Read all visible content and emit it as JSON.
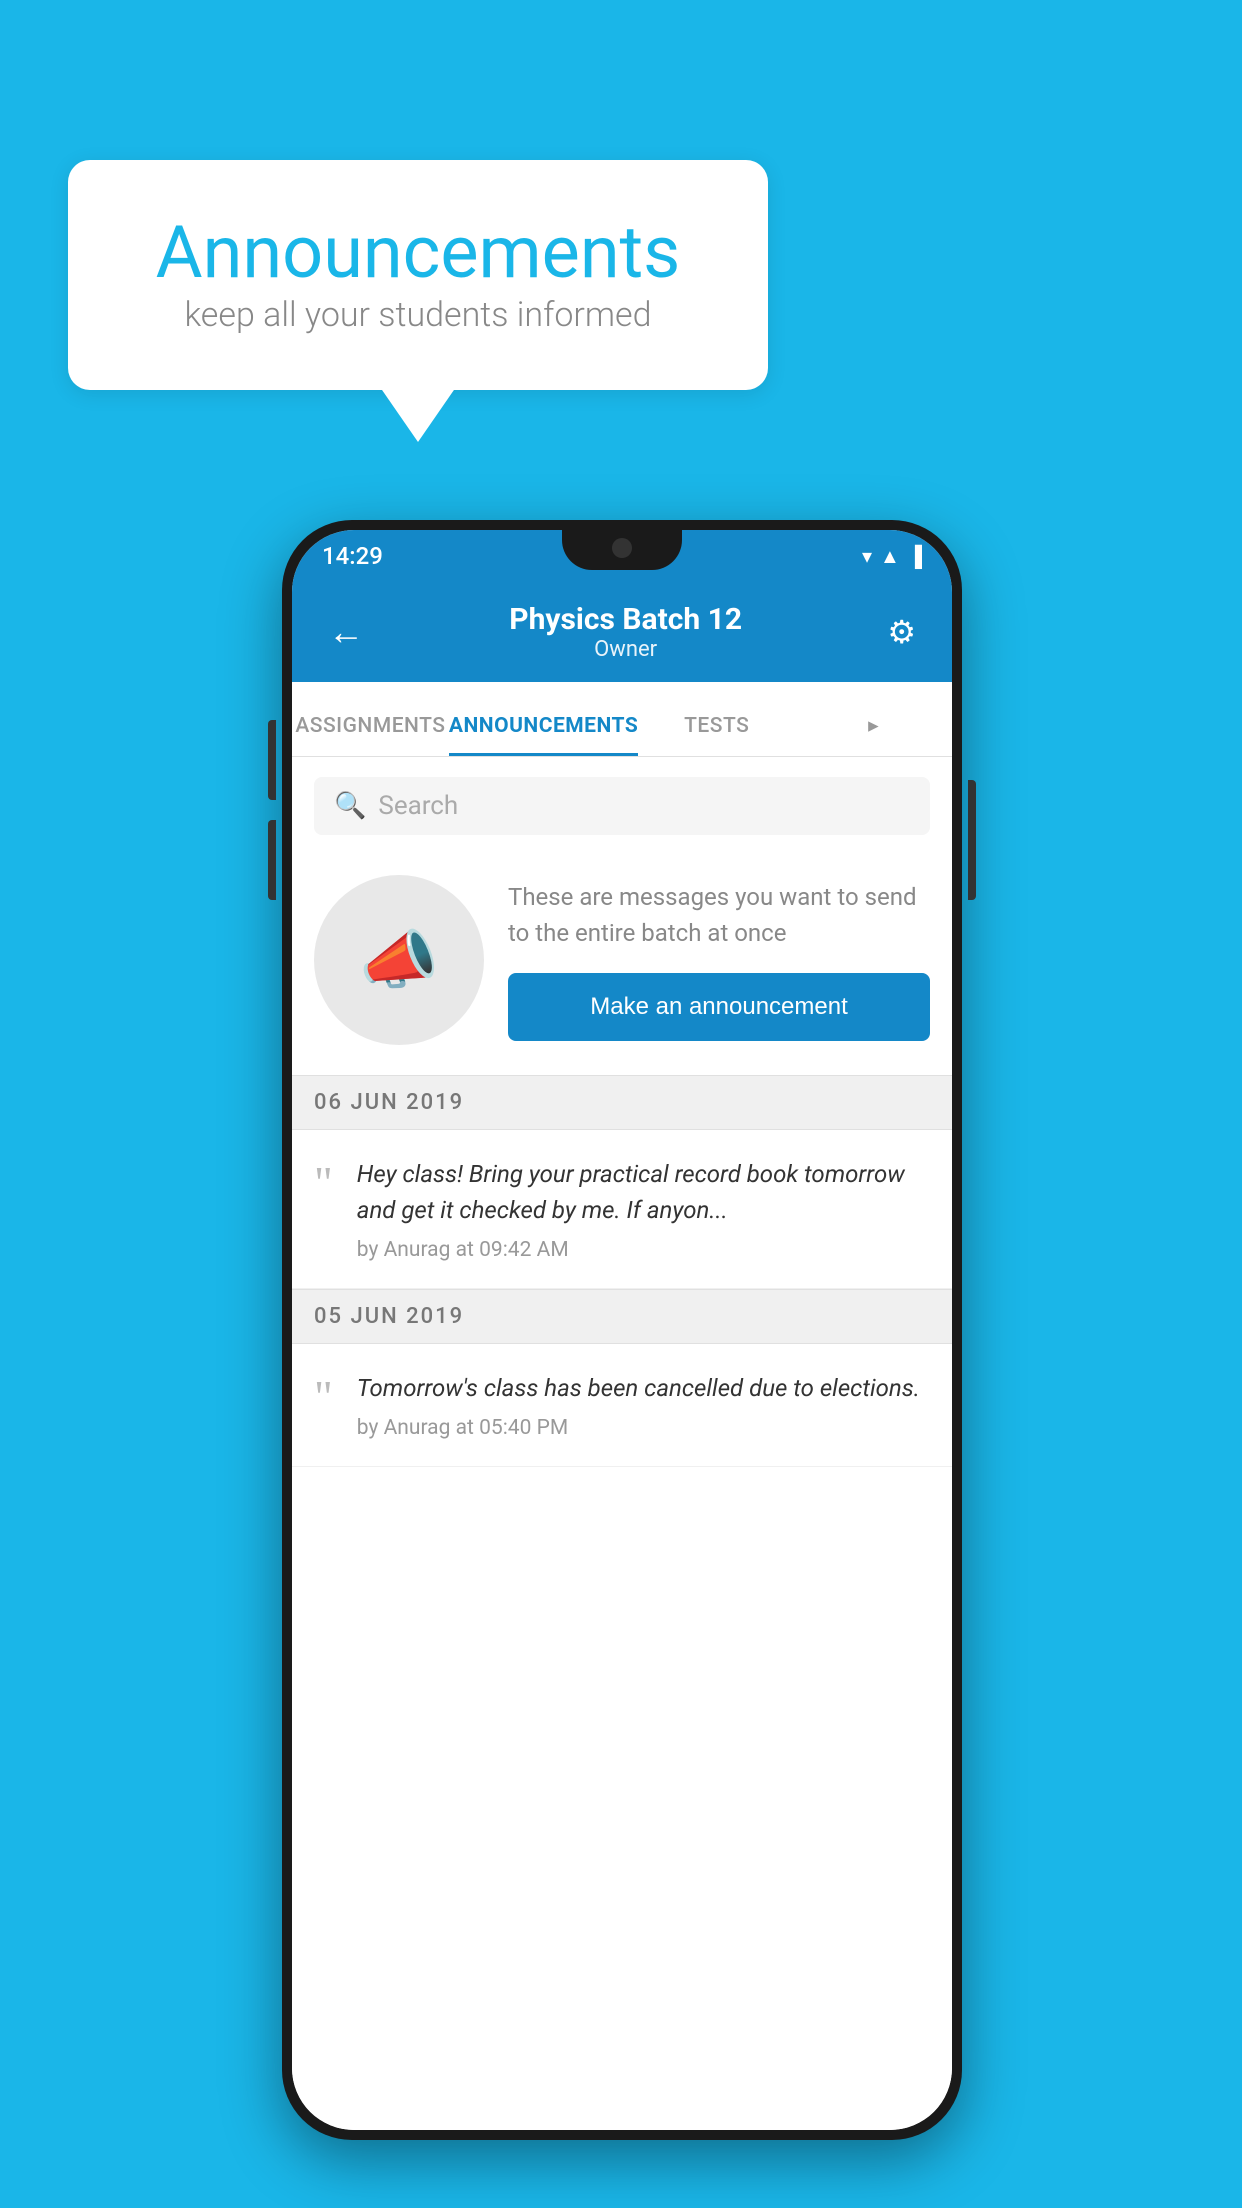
{
  "background_color": "#1ab6e8",
  "speech_bubble": {
    "title": "Announcements",
    "subtitle": "keep all your students informed"
  },
  "phone": {
    "status_bar": {
      "time": "14:29",
      "icons": [
        "wifi",
        "signal",
        "battery"
      ]
    },
    "app_bar": {
      "title": "Physics Batch 12",
      "subtitle": "Owner",
      "back_label": "←",
      "gear_label": "⚙"
    },
    "tabs": [
      {
        "label": "ASSIGNMENTS",
        "active": false
      },
      {
        "label": "ANNOUNCEMENTS",
        "active": true
      },
      {
        "label": "TESTS",
        "active": false
      },
      {
        "label": "...",
        "active": false
      }
    ],
    "search": {
      "placeholder": "Search"
    },
    "announcement_cta": {
      "description": "These are messages you want to send to the entire batch at once",
      "button_label": "Make an announcement"
    },
    "announcements": [
      {
        "date": "06  JUN  2019",
        "messages": [
          {
            "text": "Hey class! Bring your practical record book tomorrow and get it checked by me. If anyon...",
            "meta": "by Anurag at 09:42 AM"
          }
        ]
      },
      {
        "date": "05  JUN  2019",
        "messages": [
          {
            "text": "Tomorrow's class has been cancelled due to elections.",
            "meta": "by Anurag at 05:40 PM"
          }
        ]
      }
    ]
  }
}
